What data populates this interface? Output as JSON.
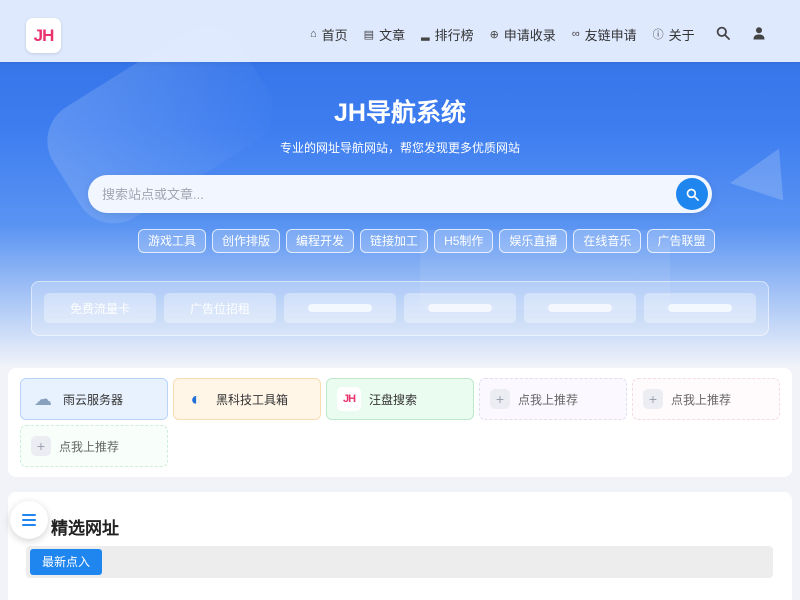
{
  "header": {
    "logo_text": "JH",
    "nav": [
      {
        "icon": "home-icon",
        "glyph": "⌂",
        "label": "首页"
      },
      {
        "icon": "document-icon",
        "glyph": "▤",
        "label": "文章"
      },
      {
        "icon": "ranking-icon",
        "glyph": "▂",
        "label": "排行榜"
      },
      {
        "icon": "plus-circle-icon",
        "glyph": "⊕",
        "label": "申请收录"
      },
      {
        "icon": "link-icon",
        "glyph": "∞",
        "label": "友链申请"
      },
      {
        "icon": "info-icon",
        "glyph": "ⓘ",
        "label": "关于"
      }
    ]
  },
  "hero": {
    "title": "JH导航系统",
    "subtitle": "专业的网址导航网站，帮您发现更多优质网站",
    "search_placeholder": "搜索站点或文章...",
    "tags": [
      "游戏工具",
      "创作排版",
      "编程开发",
      "链接加工",
      "H5制作",
      "娱乐直播",
      "在线音乐",
      "广告联盟"
    ]
  },
  "ads": {
    "items": [
      {
        "label": "免费流量卡"
      },
      {
        "label": "广告位招租"
      },
      {
        "label": ""
      },
      {
        "label": ""
      },
      {
        "label": ""
      },
      {
        "label": ""
      }
    ]
  },
  "recommend": {
    "items": [
      {
        "label": "雨云服务器",
        "icon": "cloud-weather-icon",
        "glyph": "☁",
        "type": "site"
      },
      {
        "label": "黑科技工具箱",
        "icon": "toolbox-logo-icon",
        "glyph": "◐",
        "type": "site"
      },
      {
        "label": "汪盘搜索",
        "icon": "jh-logo-icon",
        "glyph": "JH",
        "type": "site"
      },
      {
        "label": "点我上推荐",
        "icon": "plus-icon",
        "glyph": "+",
        "type": "empty"
      },
      {
        "label": "点我上推荐",
        "icon": "plus-icon",
        "glyph": "+",
        "type": "empty"
      },
      {
        "label": "点我上推荐",
        "icon": "plus-icon",
        "glyph": "+",
        "type": "empty"
      }
    ]
  },
  "featured": {
    "title": "精选网址",
    "tab_active": "最新点入"
  },
  "colors": {
    "accent": "#1f86f0",
    "logo": "#e8336d"
  }
}
